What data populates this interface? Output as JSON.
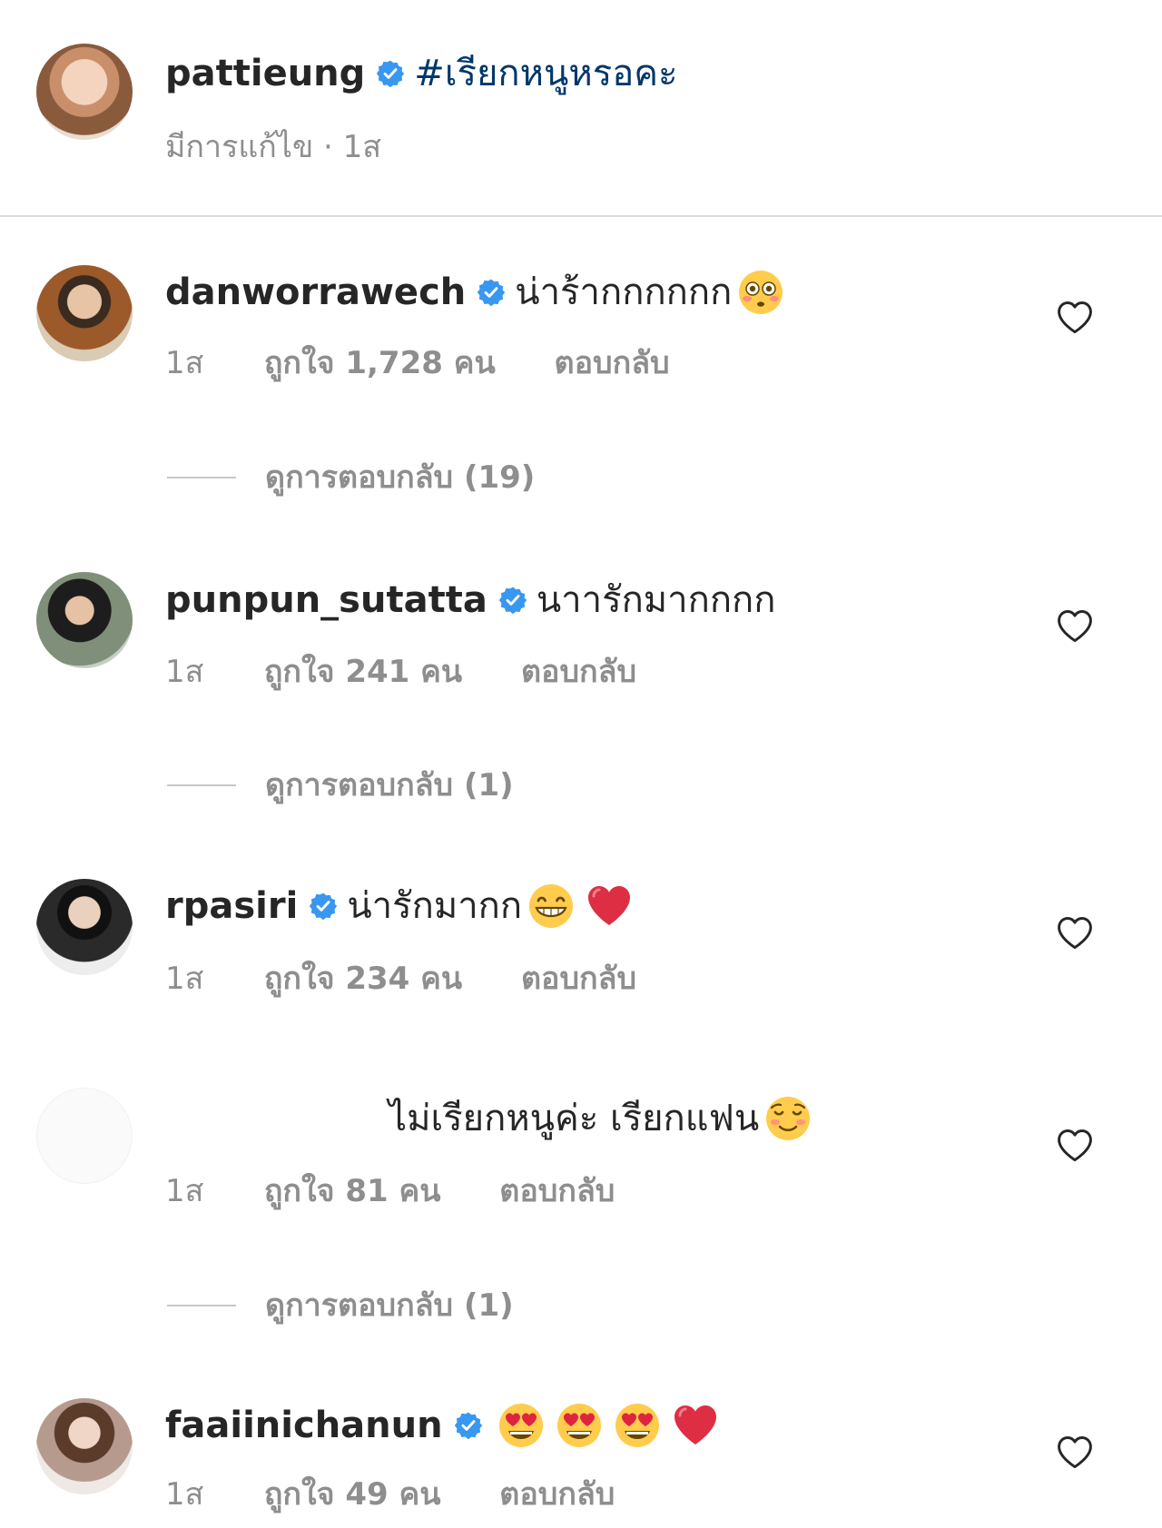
{
  "caption": {
    "username": "pattieung",
    "hashtag": "#เรียกหนูหรอคะ",
    "meta": "มีการแก้ไข · 1ส"
  },
  "comments": [
    {
      "username": "danworrawech",
      "verified": true,
      "text": "น่าร้ากกกกกก",
      "emojis": [
        "flushed-face"
      ],
      "time": "1ส",
      "likes": "ถูกใจ 1,728 คน",
      "reply": "ตอบกลับ",
      "view_replies": "ดูการตอบกลับ (19)"
    },
    {
      "username": "punpun_sutatta",
      "verified": true,
      "text": "นาารักมากกกก",
      "emojis": [],
      "time": "1ส",
      "likes": "ถูกใจ 241 คน",
      "reply": "ตอบกลับ",
      "view_replies": "ดูการตอบกลับ (1)"
    },
    {
      "username": "rpasiri",
      "verified": true,
      "text": "น่ารักมากก",
      "emojis": [
        "grinning-face",
        "red-heart"
      ],
      "time": "1ส",
      "likes": "ถูกใจ 234 คน",
      "reply": "ตอบกลับ",
      "view_replies": ""
    },
    {
      "username": "",
      "verified": false,
      "text": "ไม่เรียกหนูค่ะ เรียกแฟน",
      "emojis": [
        "smiling-face"
      ],
      "time": "1ส",
      "likes": "ถูกใจ 81 คน",
      "reply": "ตอบกลับ",
      "view_replies": "ดูการตอบกลับ (1)"
    },
    {
      "username": "faaiinichanun",
      "verified": true,
      "text": "",
      "emojis": [
        "heart-eyes-face",
        "heart-eyes-face",
        "heart-eyes-face",
        "red-heart"
      ],
      "time": "1ส",
      "likes": "ถูกใจ 49 คน",
      "reply": "ตอบกลับ",
      "view_replies": ""
    }
  ],
  "colors": {
    "verified_blue": "#3897f0",
    "meta_gray": "#8e8e8e",
    "hashtag_blue": "#00376b"
  }
}
